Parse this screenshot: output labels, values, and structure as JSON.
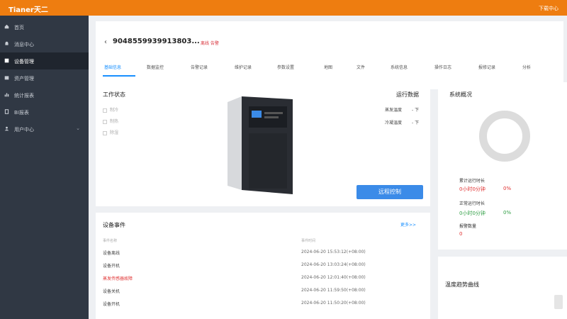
{
  "app": {
    "logo": "Tianer天二",
    "top_right": "下载中心"
  },
  "sidebar": {
    "items": [
      {
        "label": "首页",
        "icon": "home-icon"
      },
      {
        "label": "消息中心",
        "icon": "bell-icon"
      },
      {
        "label": "设备管理",
        "icon": "device-icon",
        "active": true
      },
      {
        "label": "资产管理",
        "icon": "box-icon"
      },
      {
        "label": "统计报表",
        "icon": "chart-icon"
      },
      {
        "label": "BI报表",
        "icon": "report-icon"
      },
      {
        "label": "用户中心",
        "icon": "user-icon",
        "has_submenu": true
      }
    ]
  },
  "device": {
    "back_icon": "chevron-left-icon",
    "id": "9048559939913803...",
    "status": "离线 告警"
  },
  "tabs": [
    "基础信息",
    "数据监控",
    "告警记录",
    "维护记录",
    "参数设置",
    "地图",
    "文件",
    "系统信息",
    "操作日志",
    "报修记录",
    "分析"
  ],
  "work_status": {
    "title": "工作状态",
    "modes": [
      "制冷",
      "制热",
      "除湿"
    ],
    "run_data_title": "运行数据",
    "params": [
      {
        "label": "蒸发温度",
        "value": "- 下"
      },
      {
        "label": "冷凝温度",
        "value": "- 下"
      }
    ],
    "remote_button": "远程控制"
  },
  "overview": {
    "title": "系统概况",
    "stats": [
      {
        "label": "累计运行时长",
        "value": "0小时0分钟",
        "percent": "0%",
        "color": "red"
      },
      {
        "label": "正常运行时长",
        "value": "0小时0分钟",
        "percent": "0%",
        "color": "green"
      },
      {
        "label": "报警数量",
        "value": "0",
        "percent": "",
        "color": "red"
      }
    ]
  },
  "events": {
    "title": "设备事件",
    "more": "更多>>",
    "col_name": "事件名称",
    "col_time": "事件时间",
    "rows": [
      {
        "name": "设备离线",
        "time": "2024-06-20 15:53:12(+08:00)",
        "alert": false
      },
      {
        "name": "设备开机",
        "time": "2024-06-20 13:03:24(+08:00)",
        "alert": false
      },
      {
        "name": "蒸发传感器故障",
        "time": "2024-06-20 12:01:40(+08:00)",
        "alert": true
      },
      {
        "name": "设备关机",
        "time": "2024-06-20 11:59:50(+08:00)",
        "alert": false
      },
      {
        "name": "设备开机",
        "time": "2024-06-20 11:50:20(+08:00)",
        "alert": false
      }
    ]
  },
  "trend": {
    "title": "温度趋势曲线"
  },
  "colors": {
    "brand": "#ee7d10",
    "sidebar": "#303844",
    "accent": "#1890ff",
    "danger": "#e03131",
    "success": "#2f9e44"
  }
}
